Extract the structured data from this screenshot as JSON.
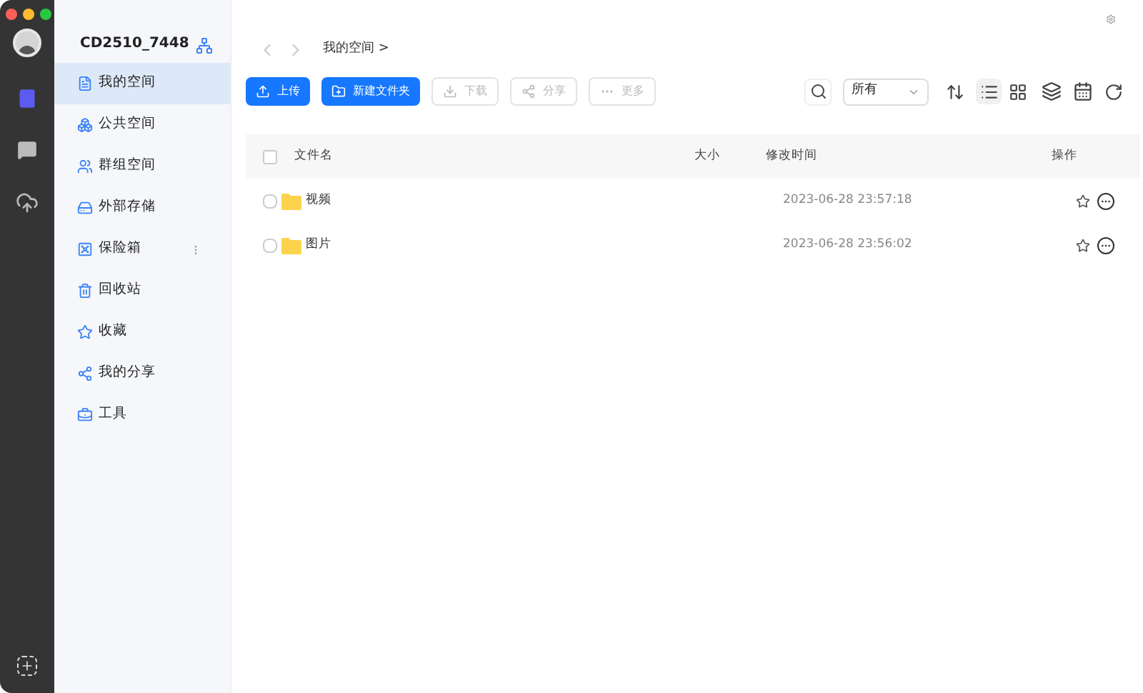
{
  "account": {
    "name": "CD2510_7448"
  },
  "nav": [
    {
      "label": "我的空间",
      "kind": "doc",
      "selected": true
    },
    {
      "label": "公共空间",
      "kind": "public",
      "selected": false
    },
    {
      "label": "群组空间",
      "kind": "group",
      "selected": false
    },
    {
      "label": "外部存储",
      "kind": "storage",
      "selected": false
    },
    {
      "label": "保险箱",
      "kind": "safe",
      "selected": false,
      "menu": true
    },
    {
      "label": "回收站",
      "kind": "trash",
      "selected": false
    },
    {
      "label": "收藏",
      "kind": "star",
      "selected": false
    },
    {
      "label": "我的分享",
      "kind": "share",
      "selected": false
    },
    {
      "label": "工具",
      "kind": "tools",
      "selected": false
    }
  ],
  "breadcrumb": {
    "path": "我的空间",
    "separator": ">"
  },
  "actions": [
    {
      "label": "上传",
      "kind": "upload",
      "disabled": false
    },
    {
      "label": "新建文件夹",
      "kind": "folder",
      "disabled": false
    },
    {
      "label": "下载",
      "kind": "download",
      "disabled": true
    },
    {
      "label": "分享",
      "kind": "share",
      "disabled": true
    },
    {
      "label": "更多",
      "kind": "more",
      "disabled": true
    }
  ],
  "filter": {
    "value": "所有"
  },
  "views": [
    {
      "kind": "list",
      "selected": true
    },
    {
      "kind": "grid",
      "selected": false
    }
  ],
  "table": {
    "all_checked": false,
    "columns": [
      "文件名",
      "大小",
      "修改时间",
      "操作"
    ],
    "rows": [
      {
        "name": "视频",
        "modified": "2023-06-28 23:57:18",
        "checked": false
      },
      {
        "name": "图片",
        "modified": "2023-06-28 23:56:02",
        "checked": false
      }
    ]
  }
}
